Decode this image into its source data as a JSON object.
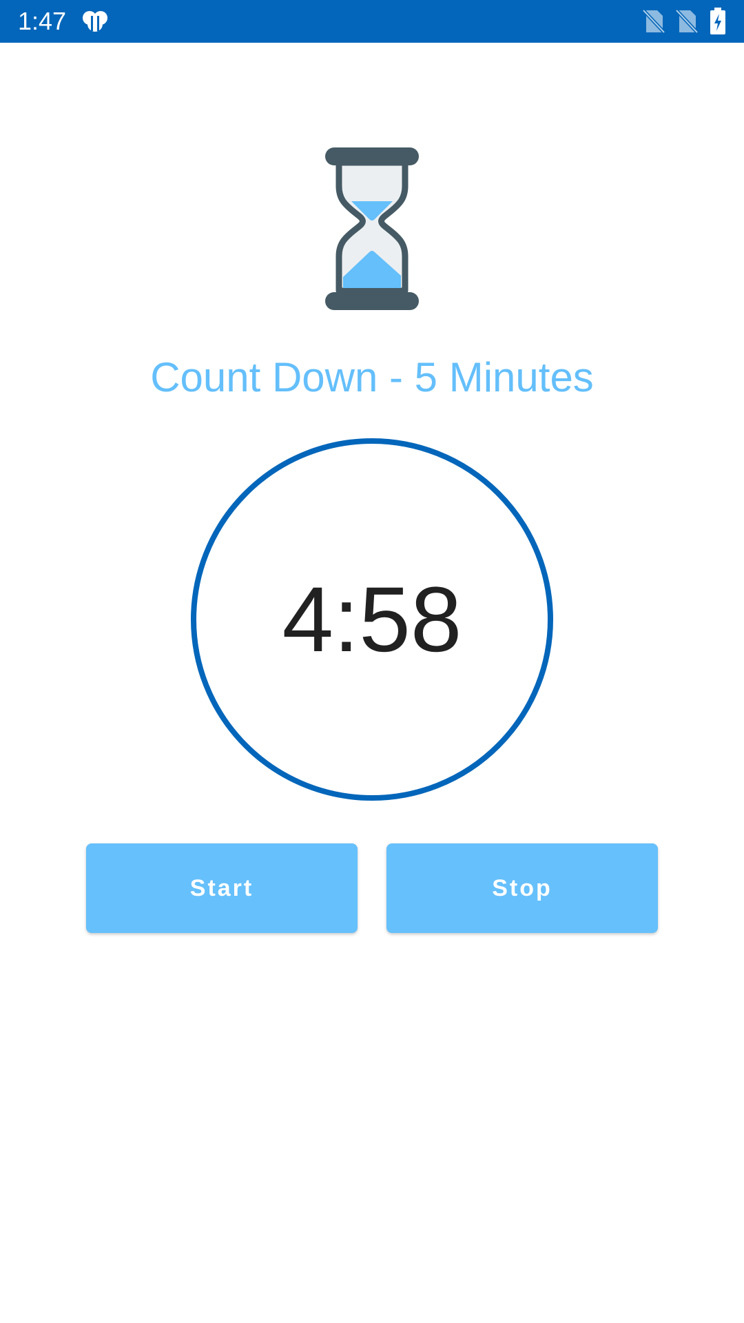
{
  "status_bar": {
    "time": "1:47",
    "background_color": "#0366BA",
    "icons": [
      "app-notification-icon",
      "no-sim-icon",
      "no-sim-icon",
      "battery-charging-icon"
    ]
  },
  "header": {
    "icon": "hourglass-icon",
    "title": "Count Down - 5 Minutes",
    "title_color": "#64BFFB"
  },
  "timer": {
    "value": "4:58",
    "ring_color": "#0366BA"
  },
  "controls": {
    "start_label": "Start",
    "stop_label": "Stop",
    "button_color": "#66C0FC"
  }
}
